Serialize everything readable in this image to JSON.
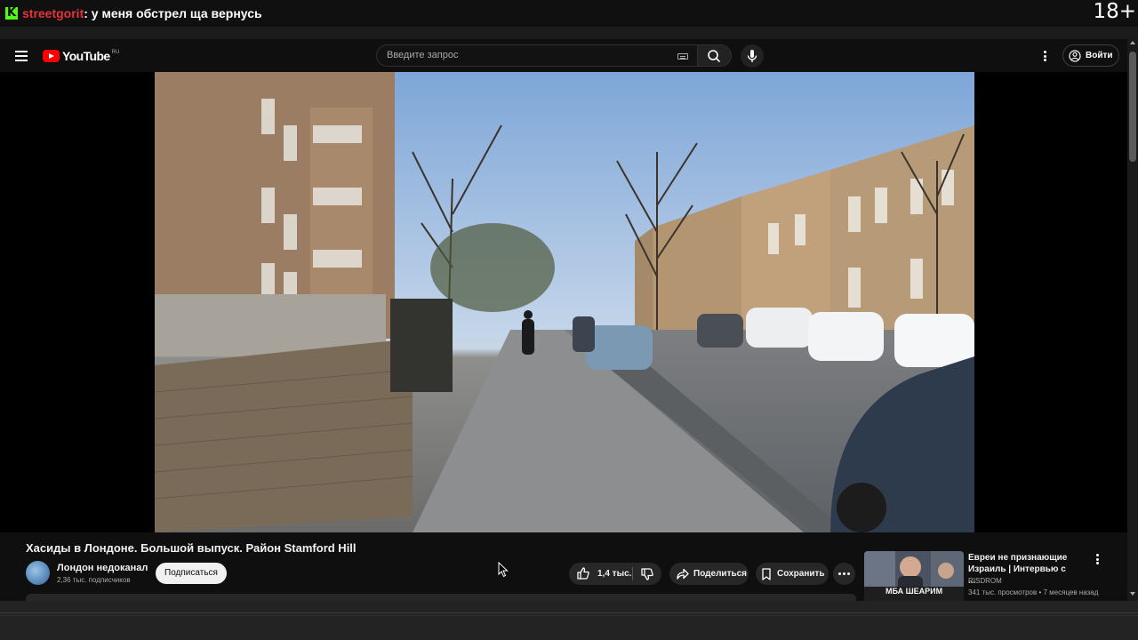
{
  "stream_overlay": {
    "logo_letter": "K",
    "username": "streetgorit",
    "message": ": у меня обстрел ща вернусь",
    "age_rating": "18+"
  },
  "header": {
    "logo_text": "YouTube",
    "region": "RU",
    "search_placeholder": "Введите запрос",
    "login_label": "Войти",
    "icons": [
      "menu-icon",
      "keyboard-icon",
      "search-icon",
      "mic-icon",
      "more-vert-icon",
      "account-icon"
    ]
  },
  "video": {
    "title": "Хасиды в Лондоне. Большой выпуск. Район Stamford Hill"
  },
  "channel": {
    "name": "Лондон недоканал",
    "subscribers": "2,36 тыс. подписчиков",
    "subscribe_label": "Подписаться"
  },
  "actions": {
    "likes": "1,4 тыс.",
    "share_label": "Поделиться",
    "save_label": "Сохранить"
  },
  "recommendation": {
    "title": "Евреи не признающие Израиль | Интервью с ...",
    "channel": "RISDROM",
    "meta": "341 тыс. просмотров • 7 месяцев назад",
    "thumb_caption": "МБА ШЕАРИМ"
  },
  "colors": {
    "youtube_red": "#ff0000",
    "kick_green": "#53fc18",
    "stream_user_red": "#e8323a",
    "background": "#0f0f0f"
  }
}
